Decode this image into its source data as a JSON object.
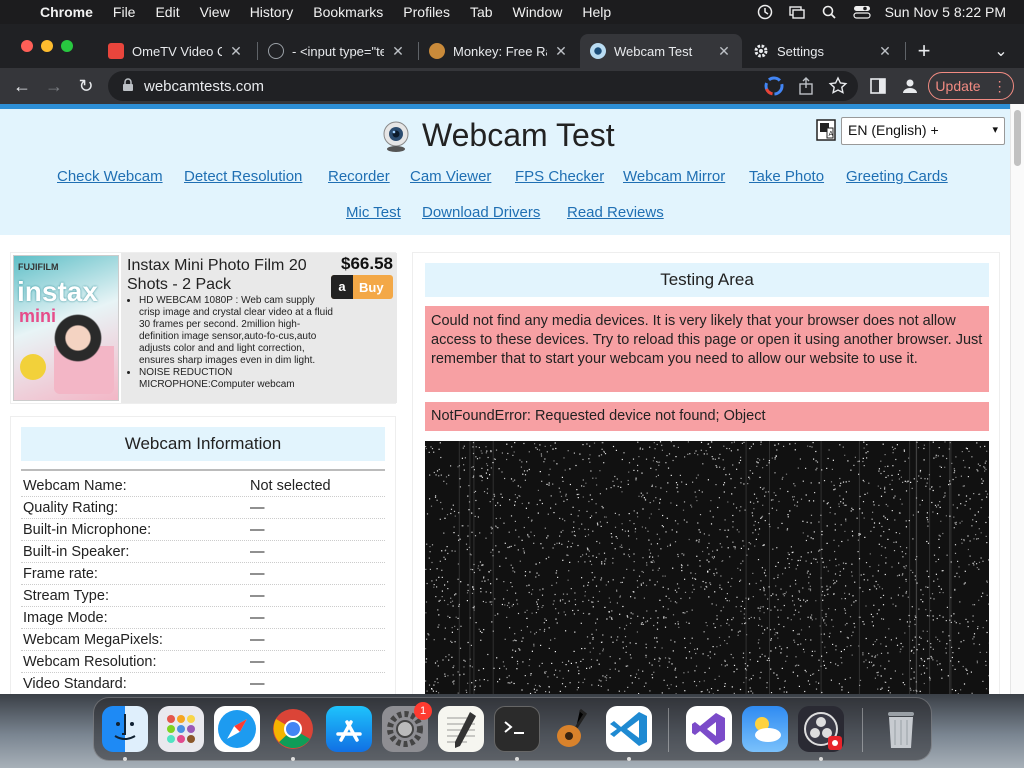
{
  "menubar": {
    "apple_glyph": "",
    "items": [
      "Chrome",
      "File",
      "Edit",
      "View",
      "History",
      "Bookmarks",
      "Profiles",
      "Tab",
      "Window",
      "Help"
    ],
    "clock": "Sun Nov 5  8:22 PM"
  },
  "tabs": [
    {
      "title": "OmeTV Video Ch",
      "icon_color": "#e8453c"
    },
    {
      "title": "- <input type=\"te",
      "icon_color": "#9aa0a6"
    },
    {
      "title": "Monkey: Free Ran",
      "icon_color": "#c98a3a"
    },
    {
      "title": "Webcam Test",
      "icon_color": "#4aa3df"
    },
    {
      "title": "Settings",
      "icon_color": "#9aa0a6"
    }
  ],
  "tab_controls": {
    "close": "✕",
    "new_tab": "+",
    "menu": "⌄"
  },
  "toolbar": {
    "back": "←",
    "forward": "→",
    "reload": "↻",
    "url": "webcamtests.com",
    "update_label": "Update",
    "update_more": "⋮"
  },
  "site": {
    "title": "Webcam Test",
    "language": "EN (English) +",
    "language_caret": "▾",
    "nav": [
      "Check Webcam",
      "Detect Resolution",
      "Recorder",
      "Cam Viewer",
      "FPS Checker",
      "Webcam Mirror",
      "Take Photo",
      "Greeting Cards",
      "Mic Test",
      "Download Drivers",
      "Read Reviews"
    ]
  },
  "ad": {
    "brand": "FUJIFILM",
    "product_word": "instax",
    "product_sub": "mini",
    "title": "Instax Mini Photo Film 20 Shots - 2 Pack",
    "price": "$66.58",
    "buy_label": "Buy",
    "amazon_glyph": "a",
    "bullets": [
      "HD WEBCAM 1080P : Web cam supply crisp image and crystal clear video at a fluid 30 frames per second. 2million high-definition image sensor,auto-fo-cus,auto adjusts color and and light correction, ensures sharp images even in dim light.",
      "NOISE REDUCTION MICROPHONE:Computer webcam"
    ]
  },
  "webcam_info": {
    "heading": "Webcam Information",
    "rows": [
      {
        "label": "Webcam Name:",
        "value": "Not selected"
      },
      {
        "label": "Quality Rating:",
        "value": "—"
      },
      {
        "label": "Built-in Microphone:",
        "value": "—"
      },
      {
        "label": "Built-in Speaker:",
        "value": "—"
      },
      {
        "label": "Frame rate:",
        "value": "—"
      },
      {
        "label": "Stream Type:",
        "value": "—"
      },
      {
        "label": "Image Mode:",
        "value": "—"
      },
      {
        "label": "Webcam MegaPixels:",
        "value": "—"
      },
      {
        "label": "Webcam Resolution:",
        "value": "—"
      },
      {
        "label": "Video Standard:",
        "value": "—"
      }
    ]
  },
  "testing": {
    "heading": "Testing Area",
    "error_main": "Could not find any media devices. It is very likely that your browser does not allow access to these devices. Try to reload this page or open it using another browser. Just remember that to start your webcam you need to allow our website to use it.",
    "error_detail": "NotFoundError: Requested device not found; Object"
  },
  "dock": {
    "settings_badge": "1",
    "apps": [
      "finder",
      "launchpad",
      "safari",
      "chrome",
      "app-store",
      "system-settings",
      "textedit",
      "terminal",
      "garageband",
      "vscode",
      "visual-studio",
      "weather",
      "obs",
      "trash"
    ]
  },
  "colors": {
    "accent": "#1f6fb3",
    "header_bg": "#e2f4fd",
    "error_bg": "#f7a0a3",
    "update": "#f28b82"
  }
}
